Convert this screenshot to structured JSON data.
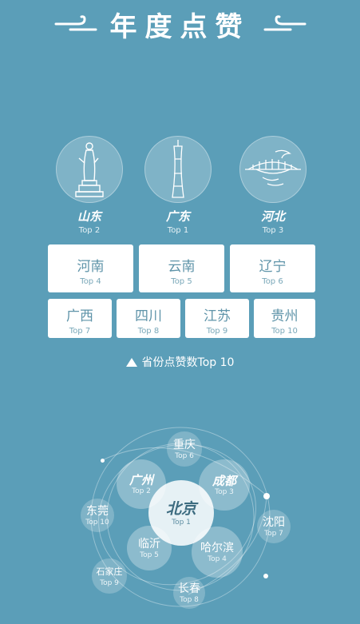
{
  "header": {
    "title": "年度点赞"
  },
  "podium": [
    {
      "province": "山东",
      "rank": "Top 2",
      "icon": "statue-icon"
    },
    {
      "province": "广东",
      "rank": "Top 1",
      "icon": "canton-tower-icon"
    },
    {
      "province": "河北",
      "rank": "Top 3",
      "icon": "bridge-icon"
    }
  ],
  "cards_row1": [
    {
      "province": "河南",
      "rank": "Top 4"
    },
    {
      "province": "云南",
      "rank": "Top 5"
    },
    {
      "province": "辽宁",
      "rank": "Top 6"
    }
  ],
  "cards_row2": [
    {
      "province": "广西",
      "rank": "Top 7"
    },
    {
      "province": "四川",
      "rank": "Top 8"
    },
    {
      "province": "江苏",
      "rank": "Top 9"
    },
    {
      "province": "贵州",
      "rank": "Top 10"
    }
  ],
  "caption": "省份点赞数Top 10",
  "cities": [
    {
      "city": "北京",
      "rank": "Top 1"
    },
    {
      "city": "广州",
      "rank": "Top 2"
    },
    {
      "city": "成都",
      "rank": "Top 3"
    },
    {
      "city": "哈尔滨",
      "rank": "Top 4"
    },
    {
      "city": "临沂",
      "rank": "Top 5"
    },
    {
      "city": "重庆",
      "rank": "Top 6"
    },
    {
      "city": "沈阳",
      "rank": "Top 7"
    },
    {
      "city": "长春",
      "rank": "Top 8"
    },
    {
      "city": "石家庄",
      "rank": "Top 9"
    },
    {
      "city": "东莞",
      "rank": "Top 10"
    }
  ],
  "colors": {
    "background": "#5b9eb8",
    "card_text": "#5f94a9",
    "main_bubble_text": "#3d6c80"
  }
}
